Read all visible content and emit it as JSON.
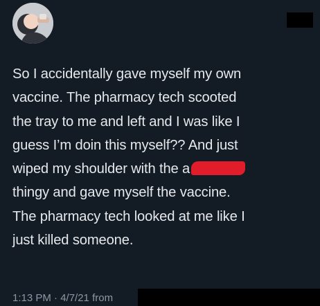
{
  "tweet": {
    "avatar_icon": "profile-avatar",
    "body_lines": [
      "So I accidentally gave myself my own",
      "vaccine. The pharmacy tech scooted",
      "the tray to me and left and I was like I",
      "guess I’m doin this myself?? And just",
      "wiped my shoulder with the a",
      "thingy and gave myself the vaccine.",
      "The pharmacy tech looked at me like I",
      "just killed someone."
    ],
    "timestamp": "1:13 PM · 4/7/21 from"
  },
  "colors": {
    "background": "#131b25",
    "text": "#e6e9ec",
    "meta_text": "#8c98a5",
    "redaction_red": "#e11d2b",
    "redaction_black": "#000000"
  }
}
